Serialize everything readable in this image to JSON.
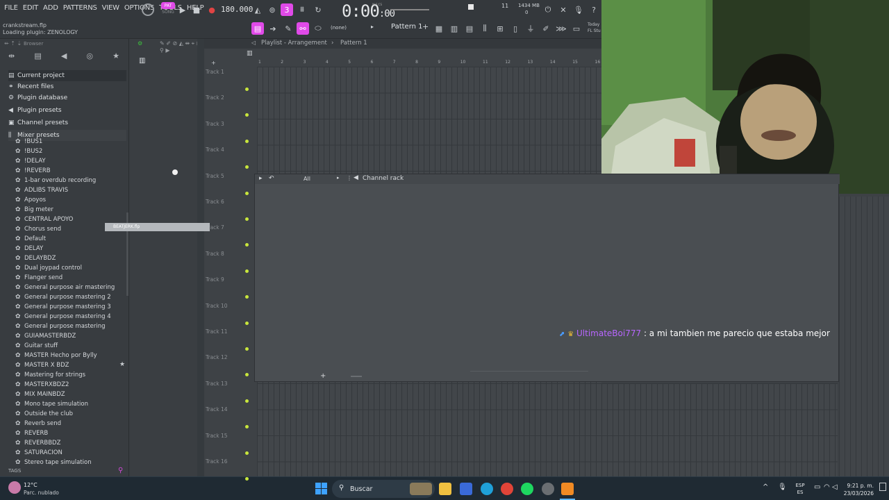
{
  "menu": [
    "FILE",
    "EDIT",
    "ADD",
    "PATTERNS",
    "VIEW",
    "OPTIONS",
    "TOOLS",
    "HELP"
  ],
  "transport": {
    "pat_label": "PAT",
    "song_label": "SONG",
    "bpm": "180.000",
    "time": "0:00",
    "time_small": ":00",
    "time_unit": "M:S:CS",
    "cpu": "11",
    "mem": "1434 MB",
    "poly": "0"
  },
  "project": {
    "file": "crankstream.flp",
    "status": "Loading plugin: ZENOLOGY"
  },
  "pattern": {
    "snap": "(none)",
    "name": "Pattern 1",
    "today": "Today",
    "studio": "FL Stu"
  },
  "browser": {
    "title": "Browser",
    "folders": [
      "Current project",
      "Recent files",
      "Plugin database",
      "Plugin presets",
      "Channel presets",
      "Mixer presets"
    ],
    "presets": [
      "!BUS1",
      "!BUS2",
      "!DELAY",
      "!REVERB",
      "1-bar overdub recording",
      "ADLIBS TRAVIS",
      "Apoyos",
      "Big meter",
      "CENTRAL APOYO",
      "Chorus send",
      "Default",
      "DELAY",
      "DELAYBDZ",
      "Dual joypad control",
      "Flanger send",
      "General purpose air mastering",
      "General purpose mastering 2",
      "General purpose mastering 3",
      "General purpose mastering 4",
      "General purpose mastering",
      "GUIAMASTERBDZ",
      "Guitar stuff",
      "MASTER Hecho por Bylly",
      "MASTER X BDZ",
      "Mastering for strings",
      "MASTERXBDZ2",
      "MIX MAINBDZ",
      "Mono tape simulation",
      "Outside the club",
      "Reverb send",
      "REVERB",
      "REVERBBDZ",
      "SATURACION",
      "Stereo tape simulation"
    ],
    "tags": "TAGS",
    "drag_file": "BEATJERK.flp"
  },
  "playlist": {
    "breadcrumb": "Playlist - Arrangement",
    "pattern": "Pattern 1",
    "ruler": [
      "1",
      "2",
      "3",
      "4",
      "5",
      "6",
      "7",
      "8",
      "9",
      "10",
      "11",
      "12",
      "13",
      "14",
      "15",
      "16"
    ],
    "tracks": [
      "Track 1",
      "Track 2",
      "Track 3",
      "Track 4",
      "Track 5",
      "Track 6",
      "Track 7",
      "Track 8",
      "Track 9",
      "Track 10",
      "Track 11",
      "Track 12",
      "Track 13",
      "Track 14",
      "Track 15",
      "Track 16"
    ]
  },
  "channel_rack": {
    "filter": "All",
    "title": "Channel rack"
  },
  "chat": {
    "user": "UltimateBoi777",
    "message": " : a mi tambien me parecio que estaba mejor"
  },
  "taskbar": {
    "temp": "12°C",
    "weather": "Parc. nublado",
    "search": "Buscar",
    "lang_top": "ESP",
    "lang_bottom": "ES",
    "time": "9:21 p. m.",
    "date": "23/03/2026"
  },
  "colors": {
    "accent_pink": "#e04ae8",
    "track_dot": "#c8e63c",
    "chat_user": "#b866ff"
  }
}
